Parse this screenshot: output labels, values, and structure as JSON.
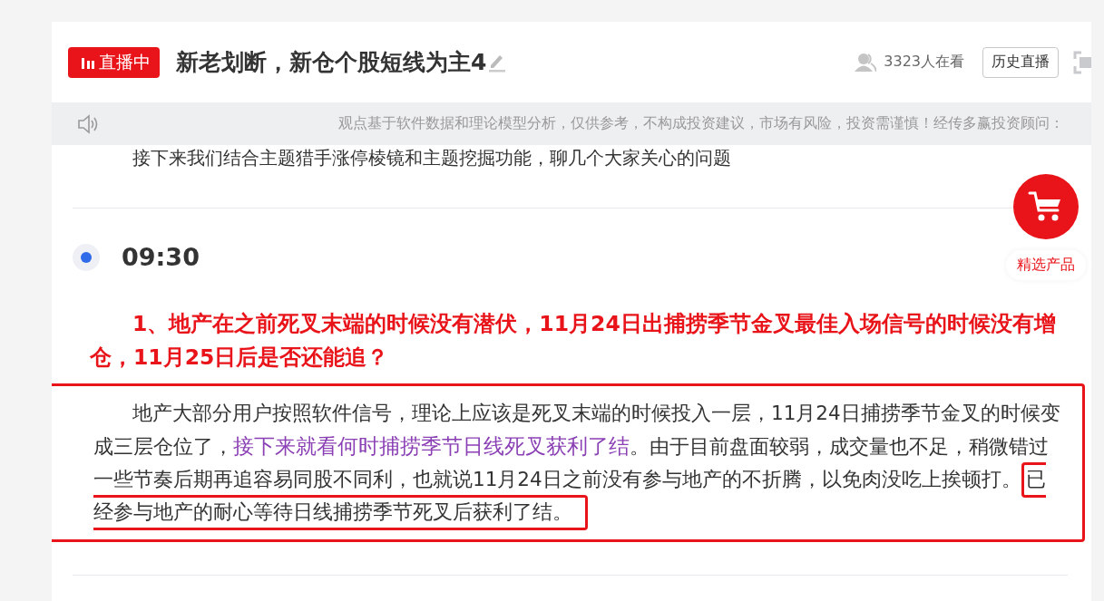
{
  "header": {
    "live_badge": "直播中",
    "title": "新老划断，新仓个股短线为主4",
    "viewers": "3323人在看",
    "history_button": "历史直播"
  },
  "notice": "观点基于软件数据和理论模型分析，仅供参考，不构成投资建议，市场有风险，投资需谨慎！经传多赢投资顾问：",
  "feed": [
    {
      "kind": "text",
      "text": "接下来我们结合主题猎手涨停棱镜和主题挖掘功能，聊几个大家关心的问题"
    },
    {
      "kind": "time",
      "text": "09:30"
    },
    {
      "kind": "heading",
      "text": "1、地产在之前死叉末端的时候没有潜伏，11月24日出捕捞季节金叉最佳入场信号的时候没有增仓，11月25日后是否还能追？"
    },
    {
      "kind": "paragraph",
      "framed": true,
      "parts": [
        {
          "kind": "plain",
          "text": "地产大部分用户按照软件信号，理论上应该是死叉末端的时候投入一层，11月24日捕捞季节金叉的时候变成三层仓位了，"
        },
        {
          "kind": "purple",
          "text": "接下来就看何时捕捞季节日线死叉获利了结"
        },
        {
          "kind": "plain",
          "text": "。由于目前盘面较弱，成交量也不足，稍微错过一些节奏后期再追容易同股不同利，也就说11月24日之前没有参与地产的不折腾，以免肉没吃上挨顿打。"
        },
        {
          "kind": "boxed",
          "text": "已经参与地产的耐心等待日线捕捞季节死叉后获利了结。"
        }
      ]
    }
  ],
  "product_button": "精选产品"
}
